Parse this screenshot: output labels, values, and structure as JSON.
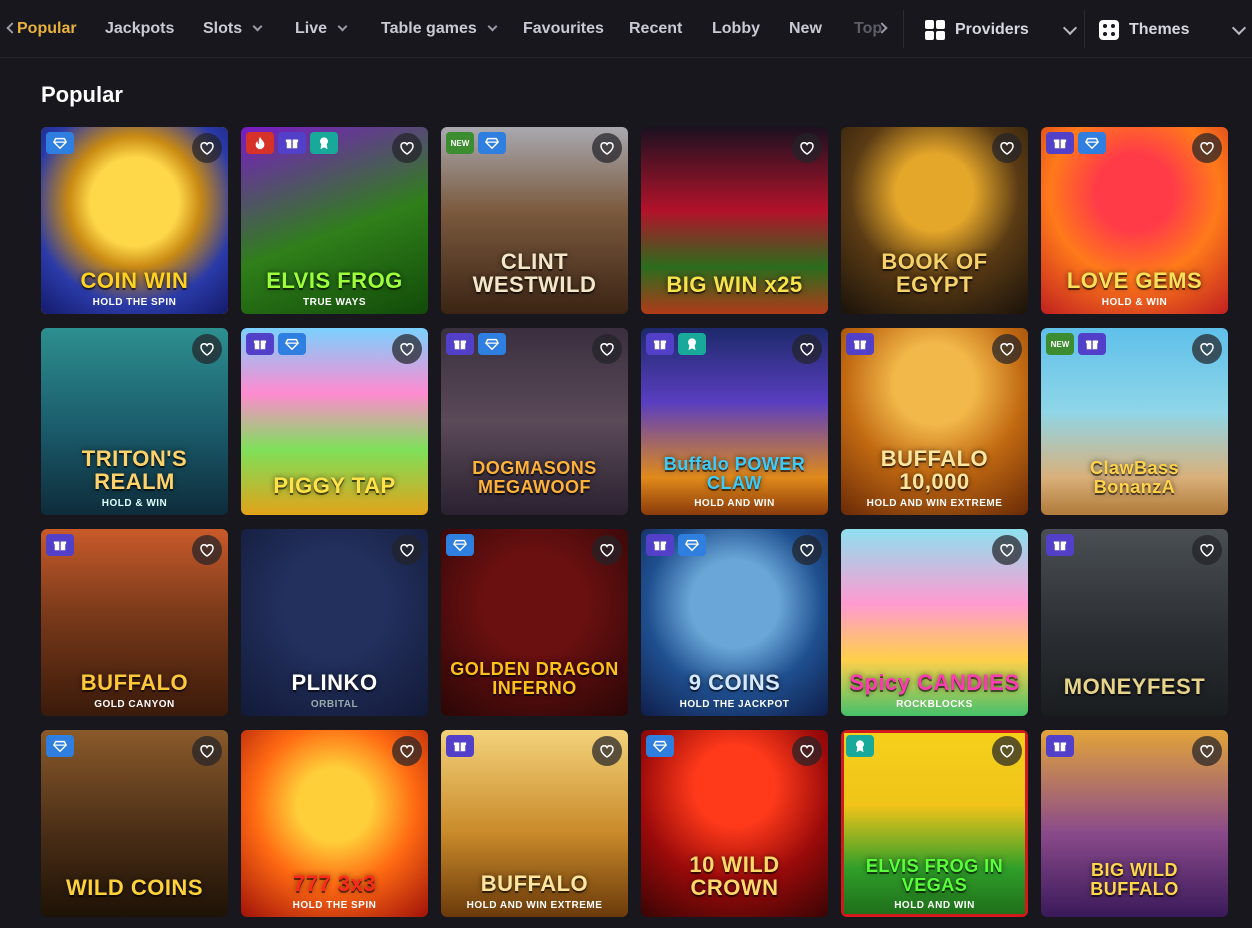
{
  "nav": {
    "tabs": [
      {
        "label": "Popular",
        "active": true
      },
      {
        "label": "Jackpots"
      },
      {
        "label": "Slots"
      },
      {
        "label": "Live"
      },
      {
        "label": "Table games"
      },
      {
        "label": "Favourites"
      },
      {
        "label": "Recent"
      },
      {
        "label": "Lobby"
      },
      {
        "label": "New"
      },
      {
        "label": "Top"
      }
    ],
    "providers_label": "Providers",
    "themes_label": "Themes"
  },
  "section": {
    "title": "Popular"
  },
  "colors": {
    "accent": "#e9b23c",
    "background": "#17171d",
    "selected_outline": "#f0c419"
  },
  "games": [
    {
      "title": "COIN WIN",
      "sub": "HOLD THE SPIN",
      "badges": [
        "diamond"
      ],
      "selected": true
    },
    {
      "title": "ELVIS FROG",
      "sub": "TRUE WAYS",
      "badges": [
        "fire",
        "gift",
        "medal"
      ]
    },
    {
      "title": "CLINT WESTWILD",
      "sub": "",
      "badges": [
        "new",
        "diamond"
      ]
    },
    {
      "title": "BIG WIN x25",
      "sub": "",
      "badges": []
    },
    {
      "title": "BOOK OF EGYPT",
      "sub": "",
      "badges": []
    },
    {
      "title": "LOVE GEMS",
      "sub": "HOLD & WIN",
      "badges": [
        "gift",
        "diamond"
      ]
    },
    {
      "title": "TRITON'S REALM",
      "sub": "HOLD & WIN",
      "badges": []
    },
    {
      "title": "PIGGY TAP",
      "sub": "",
      "badges": [
        "gift",
        "diamond"
      ]
    },
    {
      "title": "DOGMASONS MEGAWOOF",
      "sub": "",
      "badges": [
        "gift",
        "diamond"
      ]
    },
    {
      "title": "Buffalo POWER CLAW",
      "sub": "HOLD AND WIN",
      "badges": [
        "gift",
        "medal"
      ]
    },
    {
      "title": "BUFFALO 10,000",
      "sub": "HOLD AND WIN EXTREME",
      "badges": [
        "gift"
      ]
    },
    {
      "title": "ClawBass BonanzA",
      "sub": "",
      "badges": [
        "new",
        "gift"
      ]
    },
    {
      "title": "BUFFALO",
      "sub": "GOLD CANYON",
      "badges": [
        "gift"
      ]
    },
    {
      "title": "PLINKO",
      "sub": "ORBITAL",
      "badges": []
    },
    {
      "title": "GOLDEN DRAGON INFERNO",
      "sub": "",
      "badges": [
        "diamond"
      ]
    },
    {
      "title": "9 COINS",
      "sub": "HOLD THE JACKPOT",
      "badges": [
        "gift",
        "diamond"
      ]
    },
    {
      "title": "Spicy CANDIES",
      "sub": "ROCKBLOCKS",
      "badges": []
    },
    {
      "title": "MONEYFEST",
      "sub": "",
      "badges": [
        "gift"
      ]
    },
    {
      "title": "WILD COINS",
      "sub": "",
      "badges": [
        "diamond"
      ]
    },
    {
      "title": "777 3x3",
      "sub": "HOLD THE SPIN",
      "badges": []
    },
    {
      "title": "BUFFALO",
      "sub": "HOLD AND WIN EXTREME",
      "badges": [
        "gift"
      ]
    },
    {
      "title": "10 WILD CROWN",
      "sub": "",
      "badges": [
        "diamond"
      ]
    },
    {
      "title": "ELVIS FROG IN VEGAS",
      "sub": "HOLD AND WIN",
      "badges": [
        "medal"
      ]
    },
    {
      "title": "BIG WILD BUFFALO",
      "sub": "",
      "badges": [
        "gift"
      ]
    }
  ]
}
